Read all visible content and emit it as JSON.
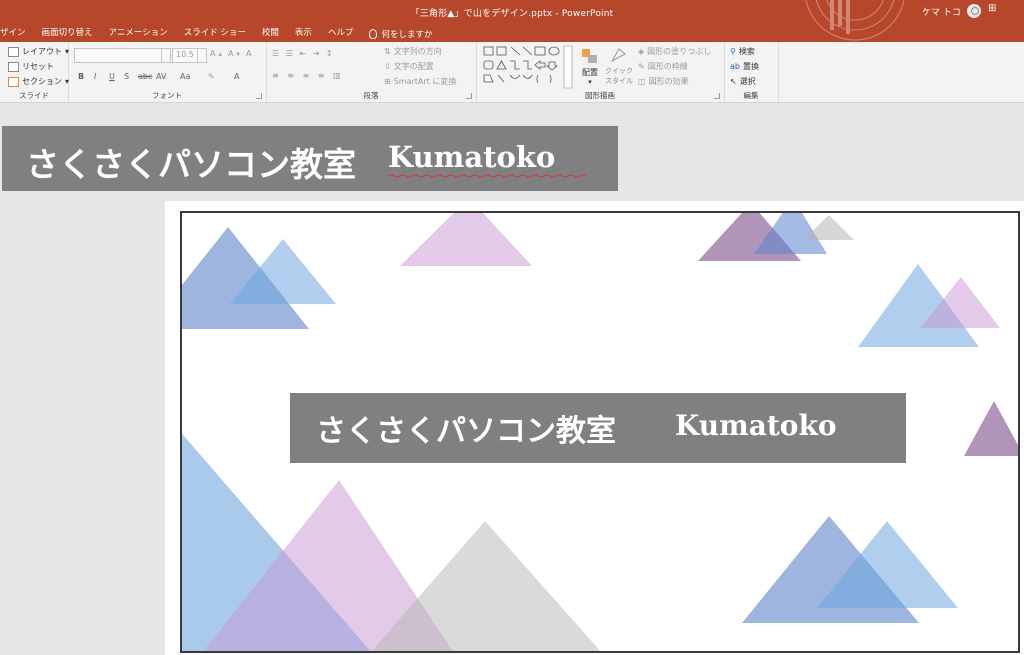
{
  "window": {
    "title": "「三角形▲」で山をデザイン.pptx  -  PowerPoint",
    "user_name": "ケマ トコ",
    "restore_icon": "ribbon-display-icon"
  },
  "tabs": [
    {
      "label": "ザイン"
    },
    {
      "label": "画面切り替え"
    },
    {
      "label": "アニメーション"
    },
    {
      "label": "スライド ショー"
    },
    {
      "label": "校閲"
    },
    {
      "label": "表示"
    },
    {
      "label": "ヘルプ"
    }
  ],
  "tell_me": "何をしますか",
  "ribbon": {
    "slides": {
      "layout": "レイアウト",
      "reset": "リセット",
      "section": "セクション",
      "label": "スライド"
    },
    "font": {
      "size_value": "10.5",
      "bold": "B",
      "italic": "I",
      "underline": "U",
      "strike": "S",
      "strikethrough2": "abc",
      "spacing": "AV",
      "case": "Aa",
      "grow": "A",
      "shrink": "A",
      "clear": "A",
      "color": "A",
      "label": "フォント"
    },
    "paragraph": {
      "text_direction": "文字列の方向",
      "align_text": "文字の配置",
      "smartart": "SmartArt に変換",
      "label": "段落"
    },
    "drawing": {
      "arrange": "配置",
      "quick_styles_1": "クイック",
      "quick_styles_2": "スタイル",
      "shape_fill": "図形の塗りつぶし",
      "shape_outline": "図形の枠線",
      "shape_effects": "図形の効果",
      "label": "図形描画"
    },
    "editing": {
      "find": "検索",
      "replace": "置換",
      "select": "選択",
      "label": "編集"
    }
  },
  "canvas": {
    "banner_left": "さくさくパソコン教室",
    "banner_right": "Kumatoko"
  },
  "slide": {
    "banner_left": "さくさくパソコン教室",
    "banner_right": "Kumatoko"
  },
  "colors": {
    "titlebar": "#b7472a",
    "blue": "#6b8fd0",
    "lightblue": "#76aee0",
    "lavender": "#cfa6d6",
    "purple": "#7b4f8b",
    "gray": "#c8c8c8",
    "banner": "#808080"
  }
}
